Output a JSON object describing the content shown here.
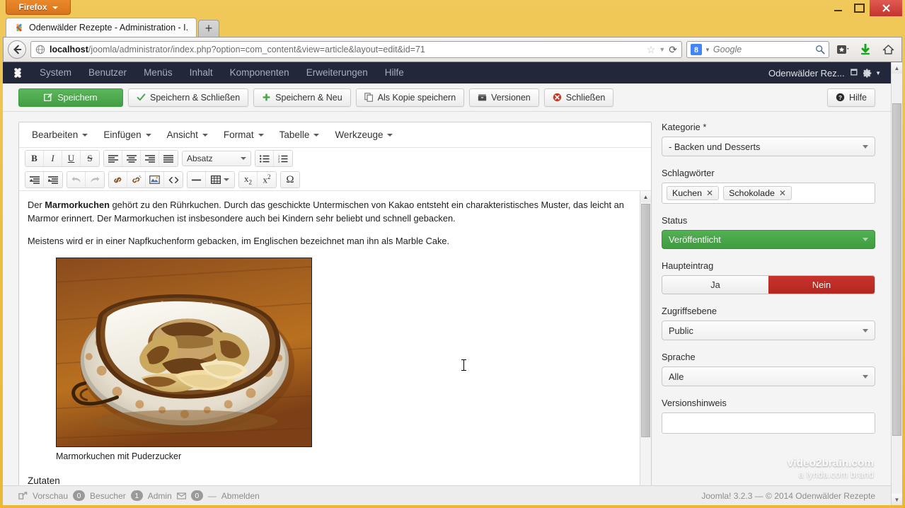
{
  "browser": {
    "app_button": "Firefox",
    "tab_title": "Odenwälder Rezepte - Administration - I...",
    "newtab_label": "+",
    "url_host": "localhost",
    "url_path": "/joomla/administrator/index.php?option=com_content&view=article&layout=edit&id=71",
    "search_engine": "Google",
    "search_placeholder": "Google",
    "window_controls": {
      "minimize": "–",
      "maximize": "□",
      "close": "✕"
    }
  },
  "adminbar": {
    "menu": [
      "System",
      "Benutzer",
      "Menüs",
      "Inhalt",
      "Komponenten",
      "Erweiterungen",
      "Hilfe"
    ],
    "site_name": "Odenwälder Rez...",
    "gear_label": ""
  },
  "toolbar": {
    "save": "Speichern",
    "save_close": "Speichern & Schließen",
    "save_new": "Speichern & Neu",
    "save_copy": "Als Kopie speichern",
    "versions": "Versionen",
    "close": "Schließen",
    "help": "Hilfe"
  },
  "editor": {
    "menus": [
      "Bearbeiten",
      "Einfügen",
      "Ansicht",
      "Format",
      "Tabelle",
      "Werkzeuge"
    ],
    "format_select": "Absatz",
    "buttons_row1": [
      "B",
      "I",
      "U",
      "S"
    ],
    "body": {
      "paragraph1_prefix": "Der ",
      "paragraph1_bold": "Marmorkuchen",
      "paragraph1_rest": " gehört zu den Rührkuchen. Durch das geschickte Untermischen von Kakao entsteht ein charakteristisches Muster, das leicht an Marmor erinnert. Der Marmorkuchen ist insbesondere auch bei Kindern sehr beliebt und schnell gebacken.",
      "paragraph2": "Meistens wird er in einer Napfkuchenform gebacken, im Englischen bezeichnet man ihn als Marble Cake.",
      "image_caption": "Marmorkuchen mit Puderzucker",
      "heading_zutaten": "Zutaten"
    }
  },
  "sidebar": {
    "kategorie_label": "Kategorie *",
    "kategorie_value": "- Backen und Desserts",
    "schlagwoerter_label": "Schlagwörter",
    "tags": [
      "Kuchen",
      "Schokolade"
    ],
    "status_label": "Status",
    "status_value": "Veröffentlicht",
    "haupteintrag_label": "Haupteintrag",
    "haupteintrag_yes": "Ja",
    "haupteintrag_no": "Nein",
    "haupteintrag_selected": "Nein",
    "zugriffsebene_label": "Zugriffsebene",
    "zugriffsebene_value": "Public",
    "sprache_label": "Sprache",
    "sprache_value": "Alle",
    "versionshinweis_label": "Versionshinweis",
    "versionshinweis_value": ""
  },
  "footer": {
    "vorschau": "Vorschau",
    "besucher_count": "0",
    "besucher": "Besucher",
    "admin_count": "1",
    "admin": "Admin",
    "mail_count": "0",
    "abmelden": "Abmelden",
    "copyright": "Joomla! 3.2.3 — © 2014 Odenwälder Rezepte"
  },
  "watermark": {
    "line1": "video2brain.com",
    "line2": "a lynda.com brand"
  },
  "colors": {
    "chrome_gold": "#e9b835",
    "admin_navy": "#22283a",
    "primary_green": "#449d44",
    "danger_red": "#b32720",
    "status_green": "#3f9c3f"
  }
}
